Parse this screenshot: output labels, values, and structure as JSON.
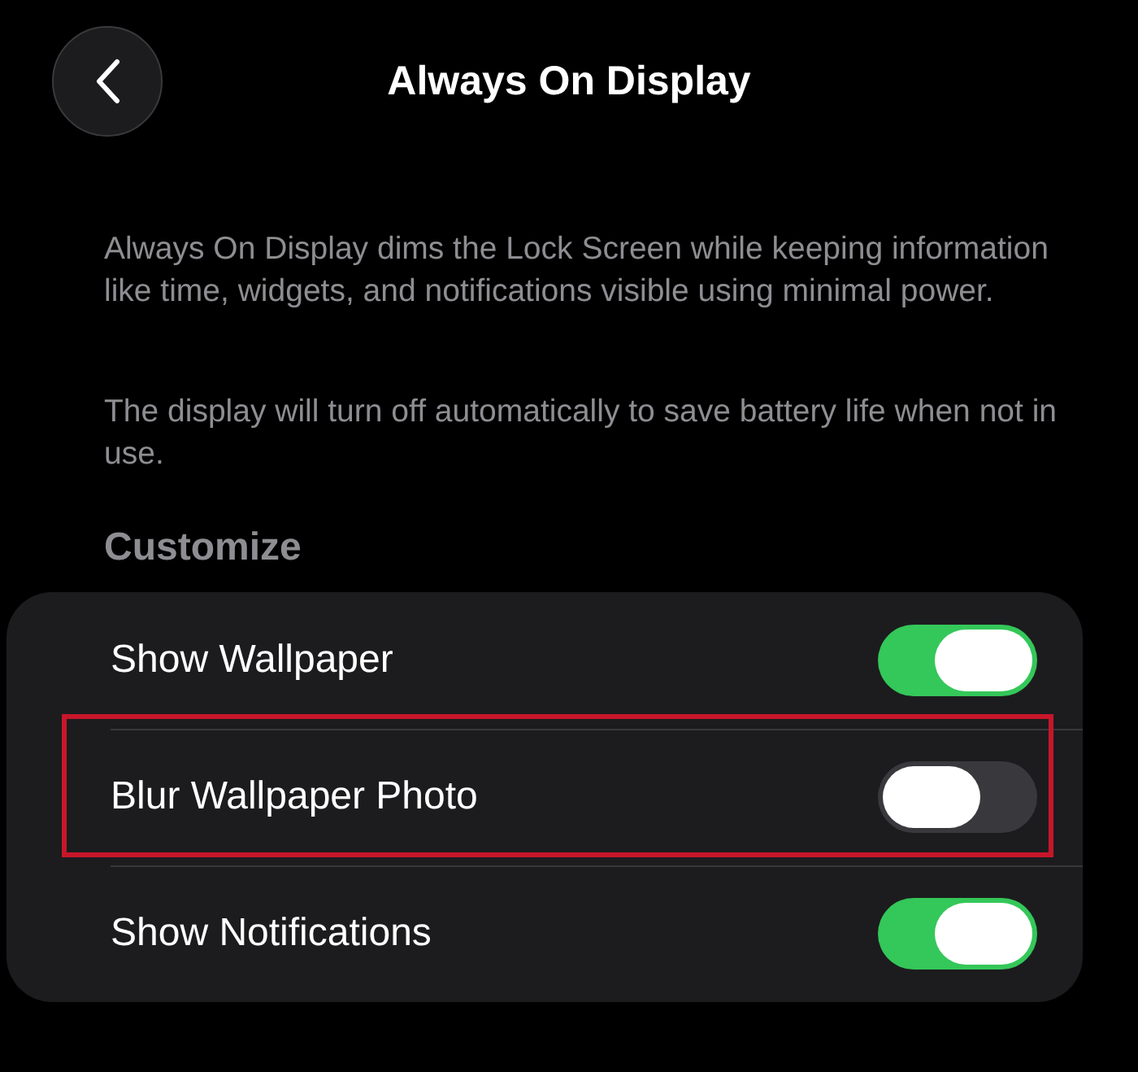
{
  "header": {
    "title": "Always On Display"
  },
  "paragraphs": [
    "Always On Display dims the Lock Screen while keeping information like time, widgets, and notifications visible using minimal power.",
    "The display will turn off automatically to save battery life when not in use."
  ],
  "section": {
    "title": "Customize"
  },
  "rows": [
    {
      "label": "Show Wallpaper",
      "on": true,
      "highlighted": false
    },
    {
      "label": "Blur Wallpaper Photo",
      "on": false,
      "highlighted": true
    },
    {
      "label": "Show Notifications",
      "on": true,
      "highlighted": false
    }
  ]
}
